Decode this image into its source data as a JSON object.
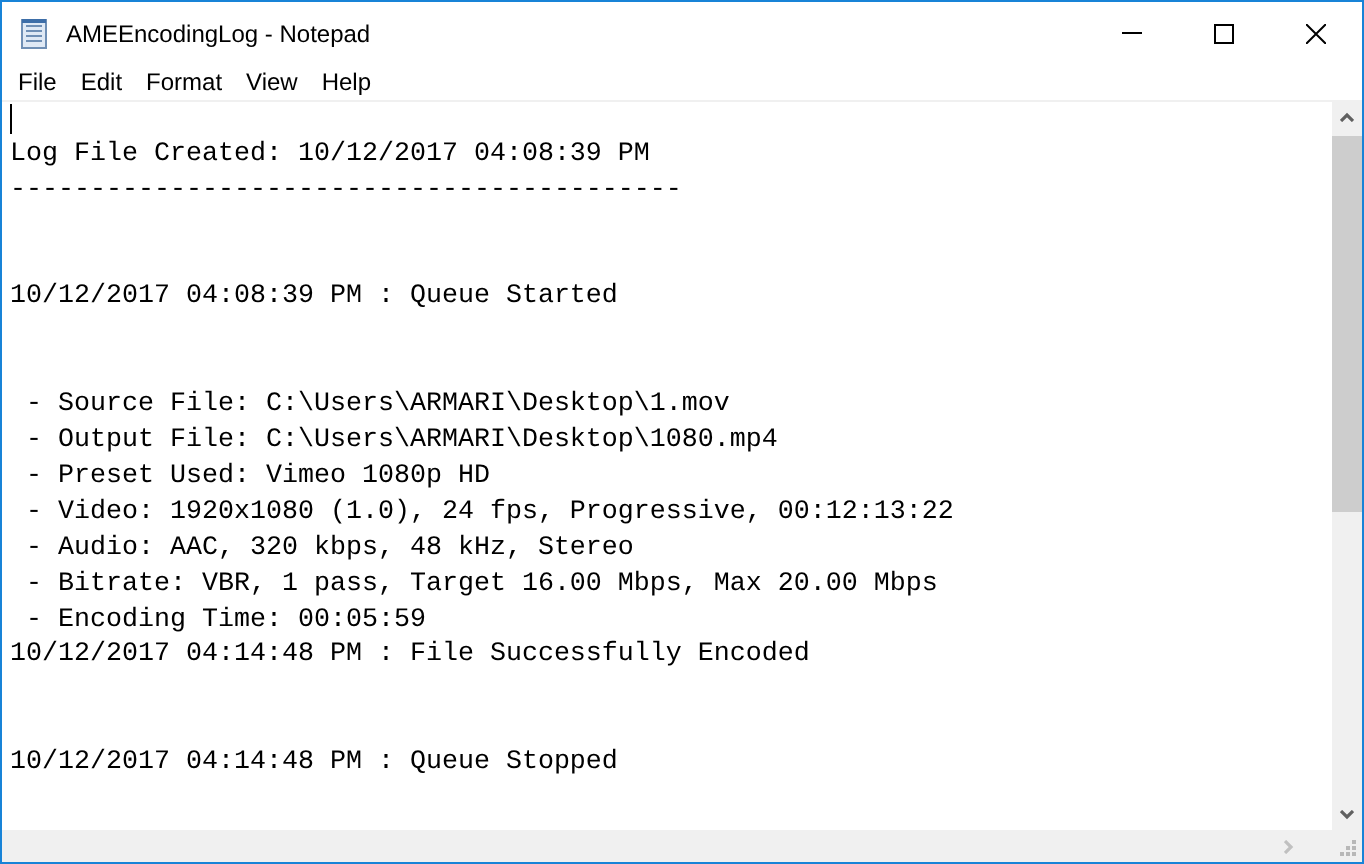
{
  "window": {
    "title": "AMEEncodingLog - Notepad"
  },
  "menu": [
    "File",
    "Edit",
    "Format",
    "View",
    "Help"
  ],
  "document": {
    "blocks": [
      {
        "lines": [
          "Log File Created: 10/12/2017 04:08:39 PM",
          "------------------------------------------"
        ]
      },
      {
        "lines": [
          "10/12/2017 04:08:39 PM : Queue Started"
        ]
      },
      {
        "lines": [
          " - Source File: C:\\Users\\ARMARI\\Desktop\\1.mov",
          " - Output File: C:\\Users\\ARMARI\\Desktop\\1080.mp4",
          " - Preset Used: Vimeo 1080p HD",
          " - Video: 1920x1080 (1.0), 24 fps, Progressive, 00:12:13:22",
          " - Audio: AAC, 320 kbps, 48 kHz, Stereo",
          " - Bitrate: VBR, 1 pass, Target 16.00 Mbps, Max 20.00 Mbps",
          " - Encoding Time: 00:05:59",
          "10/12/2017 04:14:48 PM : File Successfully Encoded"
        ]
      },
      {
        "lines": [
          "10/12/2017 04:14:48 PM : Queue Stopped"
        ]
      }
    ]
  }
}
